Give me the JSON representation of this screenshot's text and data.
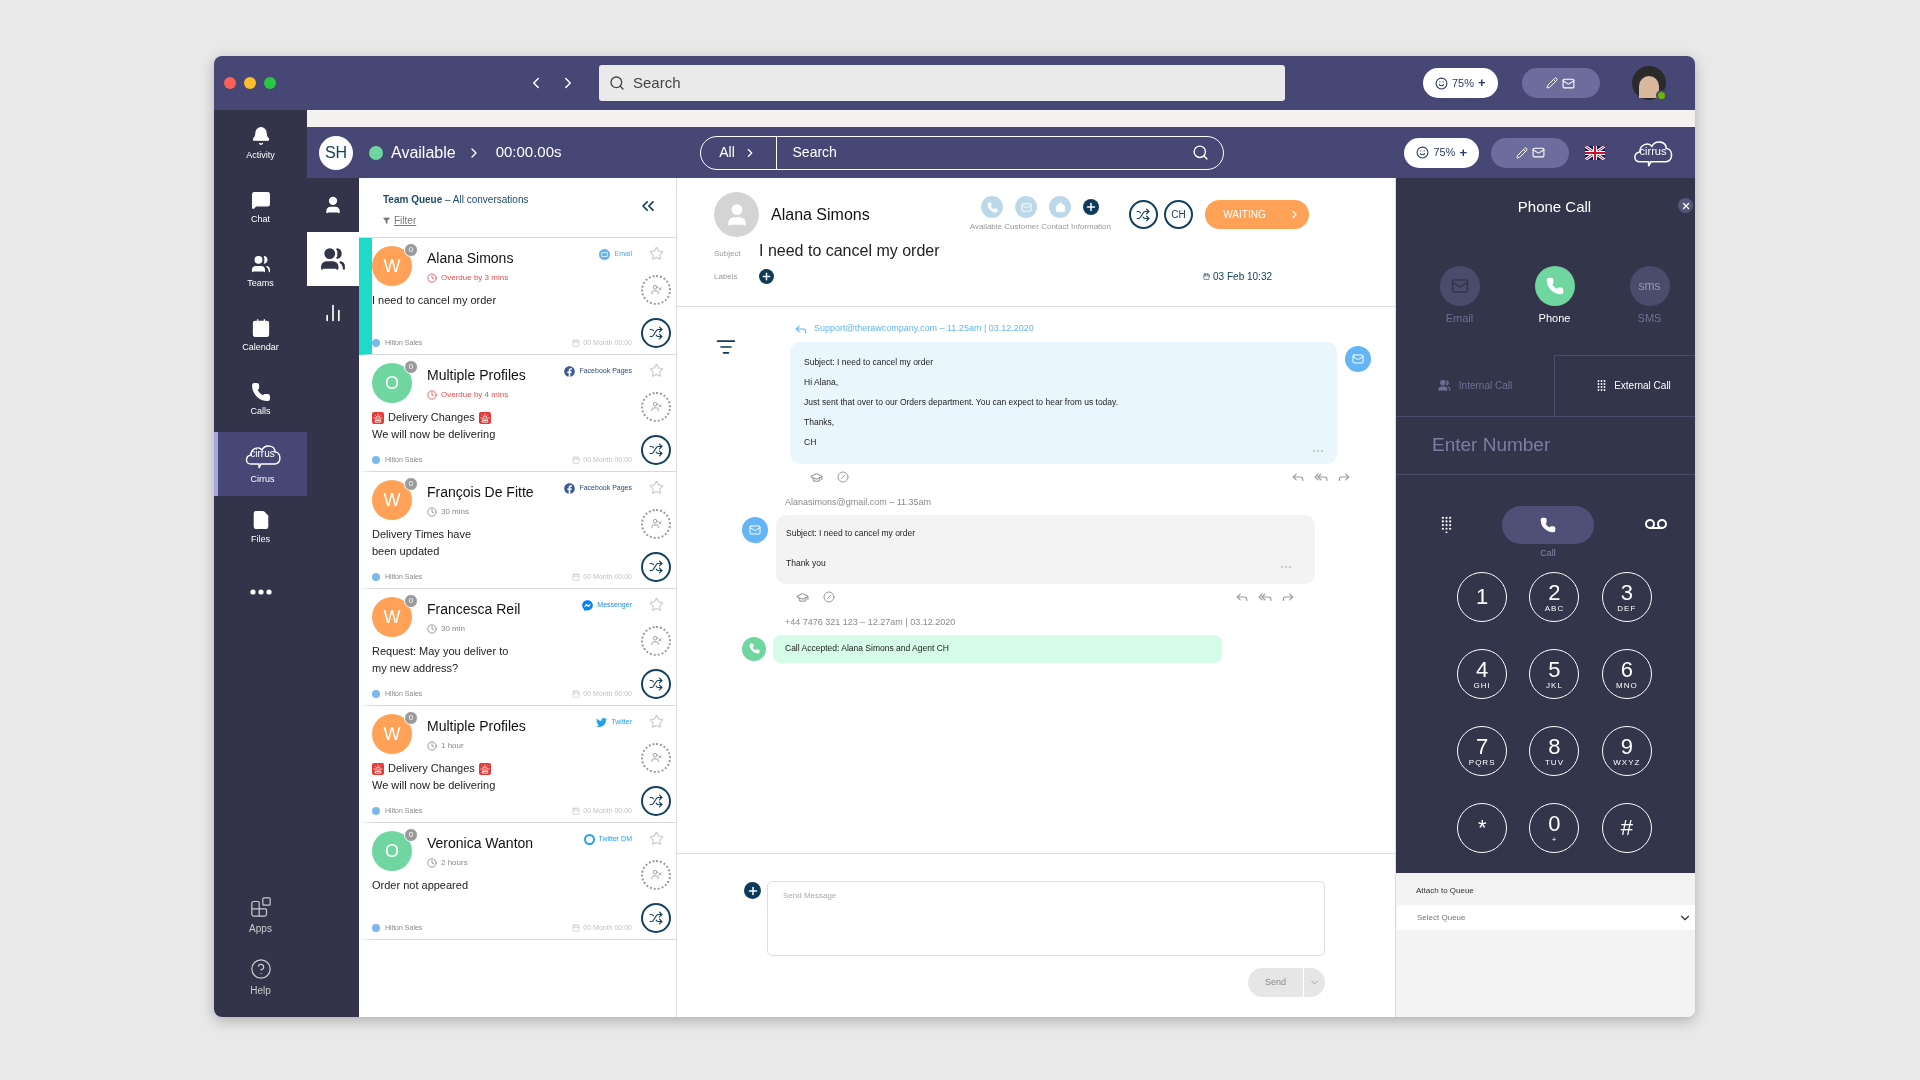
{
  "titlebar": {
    "search_placeholder": "Search",
    "mood": "75%",
    "mood_plus": "+"
  },
  "rail": {
    "items": [
      {
        "kind": "bell",
        "label": "Activity",
        "selected": false
      },
      {
        "kind": "chat",
        "label": "Chat",
        "selected": false
      },
      {
        "kind": "teams",
        "label": "Teams",
        "selected": false
      },
      {
        "kind": "calendar",
        "label": "Calendar",
        "selected": false
      },
      {
        "kind": "calls",
        "label": "Calls",
        "selected": false
      },
      {
        "kind": "cirrus",
        "label": "Cirrus",
        "logo_text": "cirrus",
        "selected": true
      },
      {
        "kind": "files",
        "label": "Files",
        "selected": false
      },
      {
        "kind": "more",
        "selected": false
      }
    ],
    "bottom": [
      {
        "kind": "apps",
        "label": "Apps"
      },
      {
        "kind": "help",
        "label": "Help"
      }
    ]
  },
  "app_header": {
    "initials": "SH",
    "status": "Available",
    "timer": "00:00.00s",
    "scope": "All",
    "search_placeholder": "Search",
    "mood": "75%",
    "mood_plus": "+",
    "logo_text": "cirrus"
  },
  "app_nav": [
    {
      "kind": "person",
      "selected": false
    },
    {
      "kind": "group",
      "selected": true
    },
    {
      "kind": "chart",
      "selected": false
    }
  ],
  "queue": {
    "title": "Team Queue",
    "subtitle": "– All conversations",
    "filter": "Filter"
  },
  "conversations": [
    {
      "name": "Alana Simons",
      "initial": "W",
      "color": "#ffa257",
      "badge": "0",
      "channel": "Email",
      "kind": "email",
      "due": "Overdue by 3 mins",
      "overdue": true,
      "sirens": false,
      "preview": [
        "I need to cancel my order"
      ],
      "team": "Hilton Sales",
      "date": "00 Month 00:00",
      "selected": true
    },
    {
      "name": "Multiple Profiles",
      "initial": "O",
      "color": "#6fd6a0",
      "badge": "0",
      "channel": "Facebook Pages",
      "kind": "facebook",
      "due": "Overdue by 4 mins",
      "overdue": true,
      "sirens": true,
      "preview": [
        "Delivery Changes",
        "We will now be delivering"
      ],
      "team": "Hilton Sales",
      "date": "00 Month 00:00",
      "selected": false
    },
    {
      "name": "François De Fitte",
      "initial": "W",
      "color": "#ffa257",
      "badge": "0",
      "channel": "Facebook Pages",
      "kind": "facebook",
      "due": "30 mins",
      "overdue": false,
      "sirens": false,
      "preview": [
        "Delivery Times have",
        "been updated"
      ],
      "team": "Hilton Sales",
      "date": "00 Month 00:00",
      "selected": false
    },
    {
      "name": "Francesca Reil",
      "initial": "W",
      "color": "#ffa257",
      "badge": "0",
      "channel": "Messenger",
      "kind": "messenger",
      "due": "30 min",
      "overdue": false,
      "sirens": false,
      "preview": [
        "Request: May you deliver to",
        "my new address?"
      ],
      "team": "Hilton Sales",
      "date": "00 Month 00:00",
      "selected": false
    },
    {
      "name": "Multiple Profiles",
      "initial": "W",
      "color": "#ffa257",
      "badge": "0",
      "channel": "Twitter",
      "kind": "twitter",
      "due": "1 hour",
      "overdue": false,
      "sirens": true,
      "preview": [
        "Delivery Changes",
        "We will now be delivering"
      ],
      "team": "Hilton Sales",
      "date": "00 Month 00:00",
      "selected": false
    },
    {
      "name": "Veronica Wanton",
      "initial": "O",
      "color": "#6fd6a0",
      "badge": "0",
      "channel": "Twitter DM",
      "kind": "twitter_dm",
      "due": "2 hours",
      "overdue": false,
      "sirens": false,
      "preview": [
        "Order not appeared"
      ],
      "team": "Hilton Sales",
      "date": "00 Month 00:00",
      "selected": false
    }
  ],
  "conversation": {
    "name": "Alana Simons",
    "contact_caption": "Available Customer Contact Information",
    "agent": "CH",
    "status": "WAITING",
    "subject_label": "Subject",
    "subject": "I need to cancel my order",
    "labels_label": "Labels",
    "date": "03 Feb 10:32"
  },
  "messages": [
    {
      "kind": "outgoing",
      "meta": "Support@therawcompany.com – 11.25am | 03.12.2020",
      "lines": [
        "Subject: I need to cancel my order",
        "Hi Alana,",
        "Just sent that over to our Orders department. You can expect to hear from us today.",
        "Thanks,",
        "CH"
      ]
    },
    {
      "kind": "incoming",
      "meta": "Alanasimons@gmail.com – 11.35am",
      "lines": [
        "Subject: I need to cancel my order",
        "Thank you"
      ]
    },
    {
      "kind": "call",
      "meta": "+44 7476 321 123 – 12.27am | 03.12.2020",
      "lines": [
        "Call Accepted: Alana Simons and Agent CH"
      ]
    }
  ],
  "composer": {
    "placeholder": "Send Message",
    "send": "Send"
  },
  "phone": {
    "title": "Phone Call",
    "channels": [
      {
        "kind": "email",
        "label": "Email",
        "selected": false
      },
      {
        "kind": "phone",
        "label": "Phone",
        "selected": true
      },
      {
        "kind": "sms",
        "label": "SMS",
        "icon_text": "sms",
        "selected": false
      }
    ],
    "call_tabs": [
      {
        "kind": "people",
        "label": "Internal Call",
        "selected": false
      },
      {
        "kind": "dialpad",
        "label": "External Call",
        "selected": true
      }
    ],
    "number_placeholder": "Enter Number",
    "call_label": "Call",
    "keys": [
      {
        "digit": "1"
      },
      {
        "digit": "2",
        "letters": "ABC"
      },
      {
        "digit": "3",
        "letters": "DEF"
      },
      {
        "digit": "4",
        "letters": "GHI"
      },
      {
        "digit": "5",
        "letters": "JKL"
      },
      {
        "digit": "6",
        "letters": "MNO"
      },
      {
        "digit": "7",
        "letters": "PQRS"
      },
      {
        "digit": "8",
        "letters": "TUV"
      },
      {
        "digit": "9",
        "letters": "WXYZ"
      },
      {
        "digit": "*"
      },
      {
        "digit": "0",
        "letters": "+"
      },
      {
        "digit": "#"
      }
    ],
    "queue_label": "Attach to Queue",
    "queue_select": "Select Queue"
  }
}
